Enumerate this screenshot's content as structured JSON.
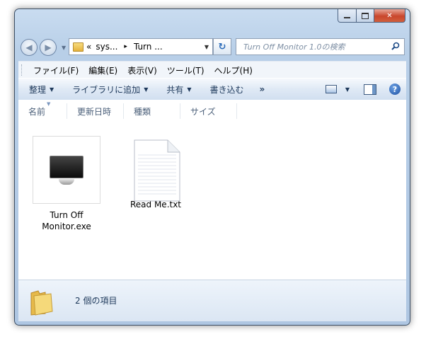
{
  "breadcrumb": {
    "overflow": "«",
    "segments": [
      "sys...",
      "Turn ..."
    ],
    "separator": "▸"
  },
  "search": {
    "placeholder": "Turn Off Monitor 1.0の検索"
  },
  "menu": [
    "ファイル(F)",
    "編集(E)",
    "表示(V)",
    "ツール(T)",
    "ヘルプ(H)"
  ],
  "commands": {
    "organize": "整理",
    "add_to_library": "ライブラリに追加",
    "share": "共有",
    "burn": "書き込む",
    "more": "»"
  },
  "columns": [
    "名前",
    "更新日時",
    "種類",
    "サイズ"
  ],
  "files": [
    {
      "name": "Turn Off Monitor.exe",
      "line1": "Turn Off",
      "line2": "Monitor.exe",
      "icon": "monitor-icon"
    },
    {
      "name": "Read Me.txt",
      "icon": "text-file-icon"
    }
  ],
  "status": {
    "item_count": "2 個の項目"
  },
  "colors": {
    "chrome": "#b8cfe8",
    "close_button": "#c9462c",
    "accent": "#1e395b"
  }
}
